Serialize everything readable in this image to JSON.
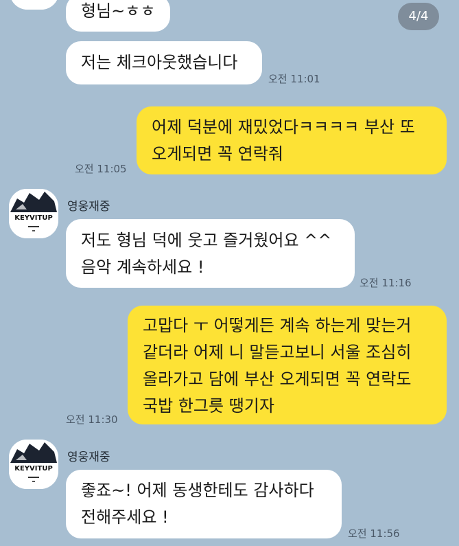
{
  "page_counter": "4/4",
  "contact_name": "영웅재중",
  "avatar_logo_text": "KEYVITUP",
  "messages": [
    {
      "direction": "in",
      "lines": [
        "형님~ㅎㅎ"
      ]
    },
    {
      "direction": "in",
      "lines": [
        "저는 체크아웃했습니다"
      ],
      "time": "오전 11:01"
    },
    {
      "direction": "out",
      "lines": [
        "어제 덕분에 재밌었다ㅋㅋㅋㅋ 부산 또",
        "오게되면 꼭 연락줘"
      ],
      "time": "오전 11:05"
    },
    {
      "direction": "in",
      "sender": "영웅재중",
      "lines": [
        "저도 형님 덕에 웃고 즐거웠어요 ^^",
        "음악 계속하세요 !"
      ],
      "time": "오전 11:16"
    },
    {
      "direction": "out",
      "lines": [
        "고맙다 ㅜ 어떻게든  계속 하는게 맞는거",
        "같더라 어제 니 말듣고보니 서울 조심히",
        "올라가고 담에 부산 오게되면 꼭 연락도",
        "국밥 한그릇 땡기자"
      ],
      "time": "오전 11:30"
    },
    {
      "direction": "in",
      "sender": "영웅재중",
      "lines": [
        "좋죠~! 어제 동생한테도 감사하다",
        "전해주세요 !"
      ],
      "time": "오전 11:56"
    }
  ],
  "colors": {
    "background": "#a7bed1",
    "incoming_bubble": "#ffffff",
    "outgoing_bubble": "#fde235",
    "timestamp": "#4a5867"
  }
}
